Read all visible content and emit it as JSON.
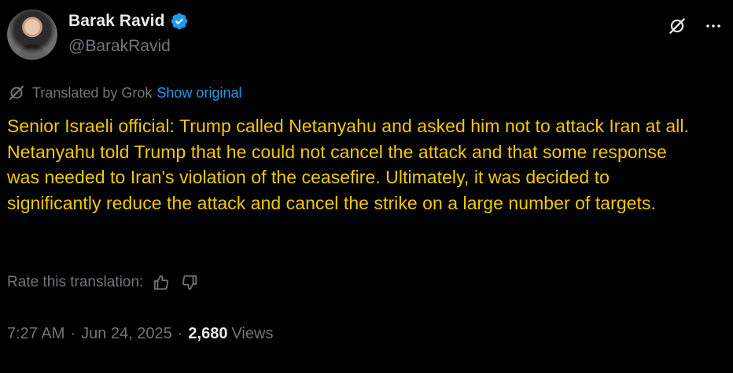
{
  "author": {
    "display_name": "Barak Ravid",
    "handle": "@BarakRavid",
    "verified": true,
    "verified_color": "#1d9bf0"
  },
  "top_actions": {
    "grok_icon": "grok-icon",
    "more_icon": "more-dots-icon"
  },
  "translation": {
    "label": "Translated by Grok",
    "show_original": "Show original"
  },
  "tweet": {
    "text": "Senior Israeli official: Trump called Netanyahu and asked him not to attack Iran at all. Netanyahu told Trump that he could not cancel the attack and that some response was needed to Iran's violation of the ceasefire. Ultimately, it was decided to significantly reduce the attack and cancel the strike on a large number of targets.",
    "text_color": "#f2c900"
  },
  "rating": {
    "label": "Rate this translation:",
    "thumbs_up_icon": "thumbs-up-icon",
    "thumbs_down_icon": "thumbs-down-icon"
  },
  "meta": {
    "time": "7:27 AM",
    "date": "Jun 24, 2025",
    "separator": "·",
    "views_count": "2,680",
    "views_label": "Views"
  },
  "colors": {
    "background": "#000000",
    "primary_text": "#e7e9ea",
    "secondary_text": "#71767b",
    "link": "#1d9bf0"
  }
}
